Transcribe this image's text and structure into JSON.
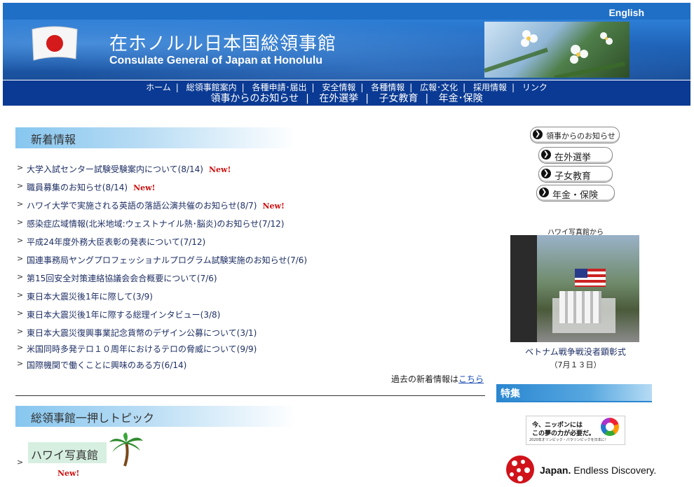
{
  "top_bar": {
    "language_link": "English"
  },
  "header": {
    "title_jp": "在ホノルル日本国総領事館",
    "title_en": "Consulate General of Japan at Honolulu"
  },
  "nav": {
    "row1": [
      "ホーム",
      "総領事館案内",
      "各種申請･届出",
      "安全情報",
      "各種情報",
      "広報･文化",
      "採用情報",
      "リンク"
    ],
    "row2": [
      "領事からのお知らせ",
      "在外選挙",
      "子女教育",
      "年金･保険"
    ]
  },
  "news": {
    "heading": "新着情報",
    "new_label": "New!",
    "items": [
      {
        "text": "大学入試センター試験受験案内について(8/14)",
        "is_new": true
      },
      {
        "text": "職員募集のお知らせ(8/14)",
        "is_new": true
      },
      {
        "text": "ハワイ大学で実施される英語の落語公演共催のお知らせ(8/7)",
        "is_new": true
      },
      {
        "text": "感染症広域情報(北米地域:ウェストナイル熱･脳炎)のお知らせ(7/12)",
        "is_new": false
      },
      {
        "text": "平成24年度外務大臣表彰の発表について(7/12)",
        "is_new": false
      },
      {
        "text": "国連事務局ヤングプロフェッショナルプログラム試験実施のお知らせ(7/6)",
        "is_new": false
      },
      {
        "text": "第15回安全対策連絡協議会会合概要について(7/6)",
        "is_new": false
      },
      {
        "text": "東日本大震災後1年に際して(3/9)",
        "is_new": false
      },
      {
        "text": "東日本大震災後1年に際する総理インタビュー(3/8)",
        "is_new": false
      },
      {
        "text": "東日本大震災復興事業記念貨幣のデザイン公募について(3/1)",
        "is_new": false
      },
      {
        "text": "米国同時多発テロ１０周年におけるテロの脅威について(9/9)",
        "is_new": false
      },
      {
        "text": "国際機関で働くことに興味のある方(6/14)",
        "is_new": false
      }
    ],
    "past_prefix": "過去の新着情報は",
    "past_link": "こちら"
  },
  "topics": {
    "heading": "総領事館一押しトピック",
    "item_label": "ハワイ写真館",
    "new_label": "New!"
  },
  "sidebar": {
    "buttons": [
      "領事からのお知らせ",
      "在外選挙",
      "子女教育",
      "年金・保険"
    ],
    "photo_top_caption": "ハワイ写真館から",
    "photo_caption": "ベトナム戦争戦没者顕彰式",
    "photo_date": "（7月１３日）",
    "special_heading": "特集",
    "olympic_banner": {
      "line1": "今、ニッポンには",
      "line2": "この夢の力が必要だ。",
      "line3": "2020年オリンピック・パラリンピックを日本に！"
    },
    "japan_brand": {
      "bold": "Japan.",
      "rest": " Endless Discovery."
    }
  }
}
